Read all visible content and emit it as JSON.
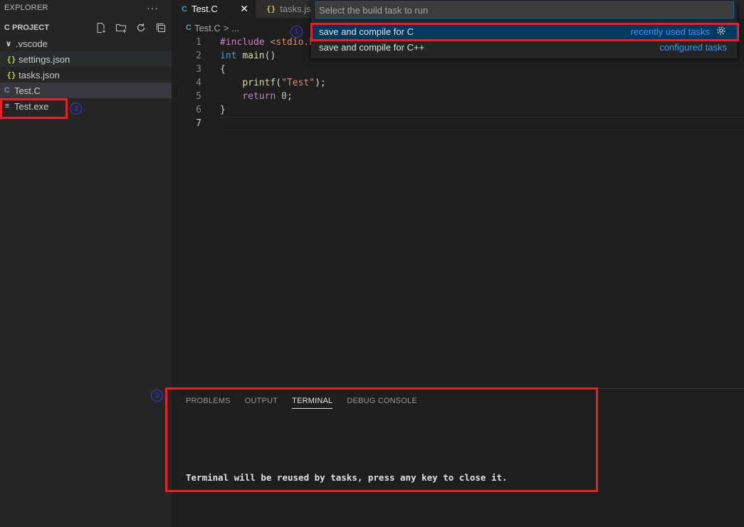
{
  "sidebar": {
    "title": "EXPLORER",
    "more": "···",
    "section_title": "C PROJECT",
    "actions": [
      "new-file-icon",
      "new-folder-icon",
      "refresh-icon",
      "collapse-all-icon"
    ],
    "tree": [
      {
        "label": ".vscode",
        "icon": "chevron-down-icon",
        "glyph": "∨"
      },
      {
        "label": "settings.json",
        "icon": "json-icon",
        "glyph": "{}"
      },
      {
        "label": "tasks.json",
        "icon": "json-icon",
        "glyph": "{}"
      },
      {
        "label": "Test.C",
        "icon": "c-file-icon",
        "glyph": "C"
      },
      {
        "label": "Test.exe",
        "icon": "file-lines-icon",
        "glyph": "≡"
      }
    ]
  },
  "tabs": [
    {
      "label": "Test.C",
      "icon": "c-file-icon",
      "glyph": "C",
      "active": true,
      "close": "✕"
    },
    {
      "label": "tasks.json",
      "icon": "json-icon",
      "glyph": "{}",
      "active": false
    }
  ],
  "breadcrumb": {
    "file": "Test.C",
    "sep": ">",
    "rest": "..."
  },
  "code": {
    "line_numbers": [
      "1",
      "2",
      "3",
      "4",
      "5",
      "6",
      "7"
    ],
    "lines": [
      {
        "parts": [
          [
            "kw-pre",
            "#include "
          ],
          [
            "str",
            "<stdio.h>"
          ]
        ]
      },
      {
        "parts": [
          [
            "kw-type",
            "int "
          ],
          [
            "fn",
            "main"
          ],
          [
            "plain",
            "()"
          ]
        ]
      },
      {
        "parts": [
          [
            "plain",
            "{"
          ]
        ]
      },
      {
        "parts": [
          [
            "plain",
            "    "
          ],
          [
            "fn",
            "printf"
          ],
          [
            "plain",
            "("
          ],
          [
            "str",
            "\"Test\""
          ],
          [
            "plain",
            ");"
          ]
        ]
      },
      {
        "parts": [
          [
            "plain",
            "    "
          ],
          [
            "kw-pre",
            "return "
          ],
          [
            "num",
            "0"
          ],
          [
            "plain",
            ";"
          ]
        ]
      },
      {
        "parts": [
          [
            "plain",
            "}"
          ]
        ]
      },
      {
        "parts": []
      }
    ]
  },
  "quickpick": {
    "placeholder": "Select the build task to run",
    "items": [
      {
        "label": "save and compile for C",
        "detail": "recently used tasks",
        "icon": "gear-icon"
      },
      {
        "label": "save and compile for C++",
        "detail": "configured tasks"
      }
    ]
  },
  "panel": {
    "tabs": [
      "PROBLEMS",
      "OUTPUT",
      "TERMINAL",
      "DEBUG CONSOLE"
    ],
    "active_tab": "TERMINAL",
    "terminal_text": "Terminal will be reused by tasks, press any key to close it."
  },
  "annotations": {
    "one": "①",
    "two": "②",
    "three": "③"
  },
  "colors": {
    "accent": "#0e639c",
    "annotation_red": "#e8202a",
    "annotation_blue": "#3b3bd6",
    "link_blue": "#3794ff"
  }
}
